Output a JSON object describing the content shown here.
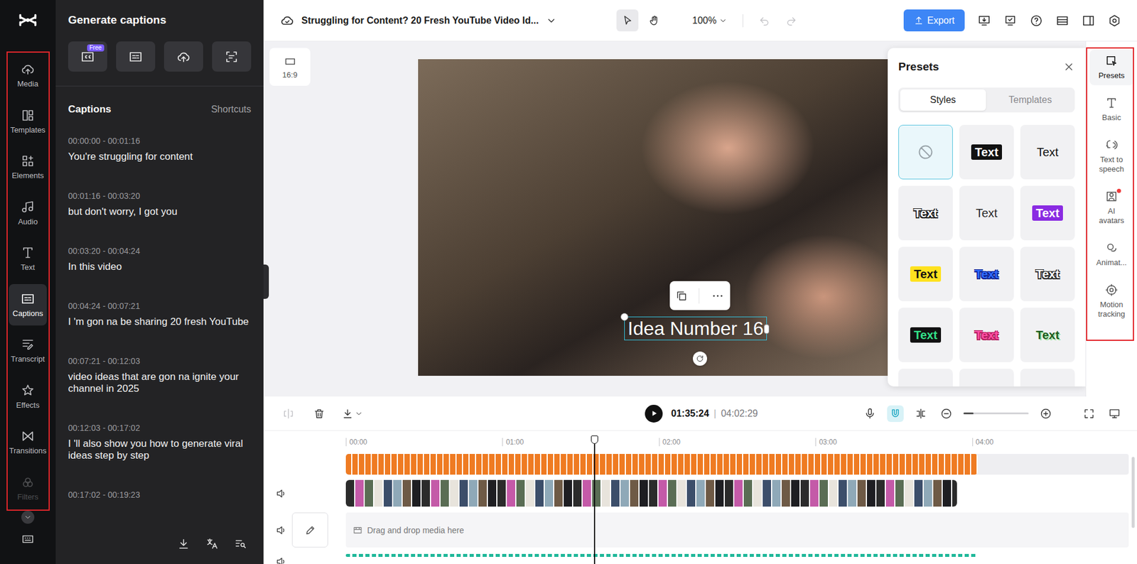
{
  "project": {
    "title": "Struggling for Content? 20 Fresh YouTube Video Id...",
    "zoom": "100%",
    "export": "Export",
    "undo_enabled": false,
    "redo_enabled": false,
    "tools": [
      {
        "selected": true
      },
      {
        "selected": false
      }
    ]
  },
  "left_rail": {
    "highlighted": true,
    "items": [
      {
        "label": "Media",
        "selected": false,
        "faded": false
      },
      {
        "label": "Templates",
        "selected": false,
        "faded": false
      },
      {
        "label": "Elements",
        "selected": false,
        "faded": false
      },
      {
        "label": "Audio",
        "selected": false,
        "faded": false
      },
      {
        "label": "Text",
        "selected": false,
        "faded": false
      },
      {
        "label": "Captions",
        "selected": true,
        "faded": false
      },
      {
        "label": "Transcript",
        "selected": false,
        "faded": false
      },
      {
        "label": "Effects",
        "selected": false,
        "faded": false
      },
      {
        "label": "Transitions",
        "selected": false,
        "faded": false
      },
      {
        "label": "Filters",
        "selected": false,
        "faded": true
      }
    ]
  },
  "captions_panel": {
    "title": "Generate captions",
    "actions": [
      {
        "badge": "Free"
      },
      {
        "badge": null
      },
      {
        "badge": null
      },
      {
        "badge": null
      }
    ],
    "list_title": "Captions",
    "shortcuts": "Shortcuts",
    "captions": [
      {
        "time": "00:00:00 - 00:01:16",
        "text": "You're struggling for content"
      },
      {
        "time": "00:01:16 - 00:03:20",
        "text": "but don't worry, I got you"
      },
      {
        "time": "00:03:20 - 00:04:24",
        "text": "In this video"
      },
      {
        "time": "00:04:24 - 00:07:21",
        "text": "I 'm gon na be sharing 20 fresh YouTube"
      },
      {
        "time": "00:07:21 - 00:12:03",
        "text": "video ideas that are gon na ignite your channel in 2025"
      },
      {
        "time": "00:12:03 - 00:17:02",
        "text": "I 'll also show you how to generate viral ideas step by step"
      },
      {
        "time": "00:17:02 - 00:19:23"
      }
    ]
  },
  "canvas": {
    "ratio": "16:9",
    "text": "Idea Number 16",
    "text_selected": true
  },
  "presets": {
    "title": "Presets",
    "tabs": [
      {
        "label": "Styles",
        "selected": true
      },
      {
        "label": "Templates",
        "selected": false
      }
    ],
    "styles": [
      {
        "kind": "none",
        "selected": true
      },
      {
        "label": "Text",
        "kind": "box",
        "color": "#ffffff",
        "background": "#111111",
        "selected": false
      },
      {
        "label": "Text",
        "kind": "plain",
        "color": "#111111",
        "selected": false
      },
      {
        "label": "Text",
        "kind": "outline",
        "color": "#ffffff",
        "outline": "#111111",
        "selected": false
      },
      {
        "label": "Text",
        "kind": "plain",
        "color": "#2a2a2a",
        "selected": false
      },
      {
        "label": "Text",
        "kind": "box",
        "color": "#ffffff",
        "background": "#8a2be2",
        "selected": false
      },
      {
        "label": "Text",
        "kind": "box",
        "color": "#111111",
        "background": "#ffe21f",
        "selected": false
      },
      {
        "label": "Text",
        "kind": "outline",
        "color": "#2f6bff",
        "outline": "#0b1f8f",
        "selected": false
      },
      {
        "label": "Text",
        "kind": "outline",
        "color": "#ffffff",
        "outline": "#222222",
        "selected": false
      },
      {
        "label": "Text",
        "kind": "box",
        "color": "#33e089",
        "background": "#111111",
        "selected": false
      },
      {
        "label": "Text",
        "kind": "outline",
        "color": "#ff4fa3",
        "outline": "#b0185b",
        "selected": false
      },
      {
        "label": "Text",
        "kind": "shadow",
        "color": "#1f5e1f",
        "outline": "#a8e6a8",
        "selected": false
      },
      {
        "kind": "cut",
        "selected": false
      },
      {
        "kind": "cut",
        "selected": false
      },
      {
        "kind": "cut",
        "selected": false
      }
    ]
  },
  "right_rail": {
    "highlighted": true,
    "items": [
      {
        "label": "Presets",
        "selected": true,
        "dot": false
      },
      {
        "label": "Basic",
        "selected": false,
        "dot": false
      },
      {
        "label": "Text to speech",
        "selected": false,
        "dot": false
      },
      {
        "label": "AI avatars",
        "selected": false,
        "dot": true
      },
      {
        "label": "Animat...",
        "selected": false,
        "dot": false
      },
      {
        "label": "Motion tracking",
        "selected": false,
        "dot": false
      }
    ]
  },
  "playback": {
    "playing": false,
    "current": "01:35:24",
    "separator": "|",
    "total": "04:02:29",
    "split_enabled": false,
    "snap_on": true,
    "zoom_level": 0.15
  },
  "timeline": {
    "ruler": [
      "00:00",
      "01:00",
      "02:00",
      "03:00",
      "04:00"
    ],
    "playhead": {
      "level": 0.318
    },
    "tracks": [
      {
        "kind": "captions",
        "level": 0.807,
        "color": "#ef7b22"
      },
      {
        "kind": "video",
        "level": 0.781
      },
      {
        "kind": "empty",
        "placeholder": "Drag and drop media here"
      },
      {
        "kind": "audio",
        "level": 0.807,
        "color": "#1fb89a"
      }
    ]
  }
}
